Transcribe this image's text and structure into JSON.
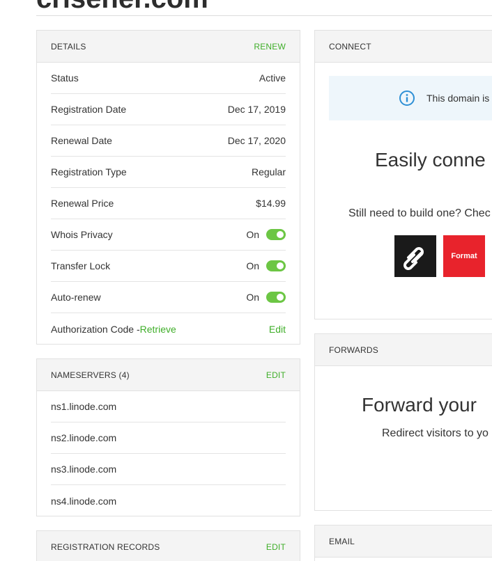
{
  "domain_title": "crisener.com",
  "details": {
    "title": "DETAILS",
    "action": "RENEW",
    "rows": [
      {
        "label": "Status",
        "value": "Active"
      },
      {
        "label": "Registration Date",
        "value": "Dec 17, 2019"
      },
      {
        "label": "Renewal Date",
        "value": "Dec 17, 2020"
      },
      {
        "label": "Registration Type",
        "value": "Regular"
      },
      {
        "label": "Renewal Price",
        "value": "$14.99"
      }
    ],
    "toggles": [
      {
        "label": "Whois Privacy",
        "value": "On"
      },
      {
        "label": "Transfer Lock",
        "value": "On"
      },
      {
        "label": "Auto-renew",
        "value": "On"
      }
    ],
    "auth": {
      "label": "Authorization Code -",
      "retrieve": "Retrieve",
      "edit": "Edit"
    }
  },
  "nameservers": {
    "title": "NAMESERVERS (4)",
    "action": "EDIT",
    "items": [
      "ns1.linode.com",
      "ns2.linode.com",
      "ns3.linode.com",
      "ns4.linode.com"
    ]
  },
  "registration_records": {
    "title": "REGISTRATION RECORDS",
    "action": "EDIT"
  },
  "connect": {
    "title": "CONNECT",
    "info_text": "This domain is",
    "heading": "Easily conne",
    "subtext": "Still need to build one? Chec",
    "logos": {
      "format": "Format"
    }
  },
  "forwards": {
    "title": "FORWARDS",
    "heading": "Forward your",
    "subtext": "Redirect visitors to yo"
  },
  "email": {
    "title": "EMAIL"
  },
  "colors": {
    "accent": "#3fae29",
    "toggle_on": "#6cc644",
    "info_bg": "#eef6fb",
    "info_icon": "#2d8fd5"
  }
}
